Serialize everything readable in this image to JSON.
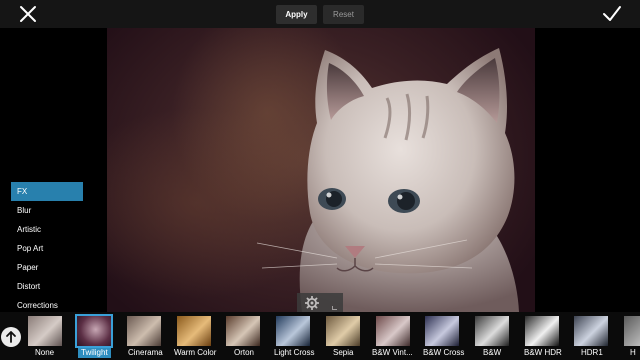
{
  "toolbar": {
    "close_icon": "close-icon",
    "apply_label": "Apply",
    "reset_label": "Reset",
    "confirm_icon": "checkmark-icon"
  },
  "categories": [
    {
      "label": "FX",
      "active": true
    },
    {
      "label": "Blur"
    },
    {
      "label": "Artistic"
    },
    {
      "label": "Pop Art"
    },
    {
      "label": "Paper"
    },
    {
      "label": "Distort"
    },
    {
      "label": "Corrections"
    }
  ],
  "filters": [
    {
      "label": "None"
    },
    {
      "label": "Twilight",
      "selected": true
    },
    {
      "label": "Cinerama"
    },
    {
      "label": "Warm Color"
    },
    {
      "label": "Orton"
    },
    {
      "label": "Light Cross"
    },
    {
      "label": "Sepia"
    },
    {
      "label": "B&W Vint..."
    },
    {
      "label": "B&W Cross"
    },
    {
      "label": "B&W"
    },
    {
      "label": "B&W HDR"
    },
    {
      "label": "HDR1"
    },
    {
      "label": "H"
    }
  ],
  "colors": {
    "accent": "#2880ad",
    "selected_outline": "#3aa0d8"
  }
}
